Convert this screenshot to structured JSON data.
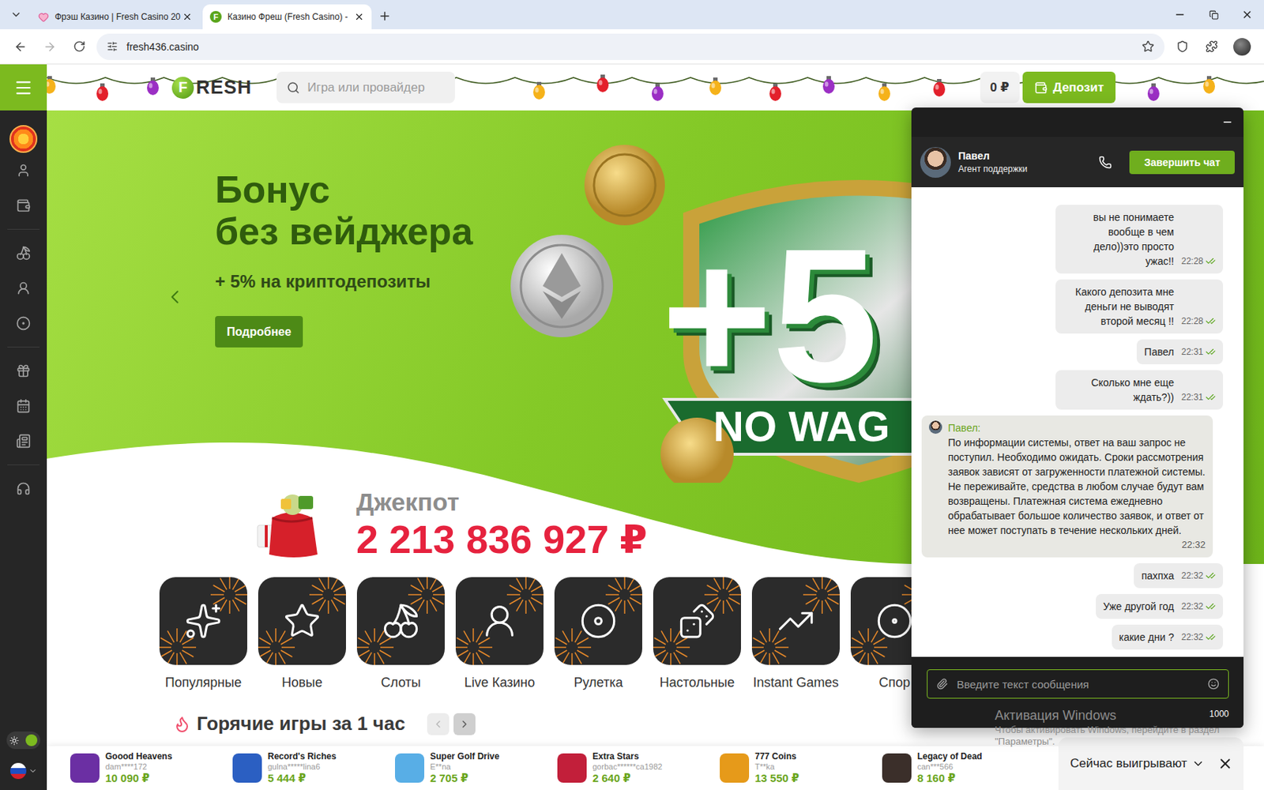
{
  "browser": {
    "tabs": [
      {
        "title": "Фрэш Казино | Fresh Casino 20",
        "selected": false,
        "kind": "heart"
      },
      {
        "title": "Казино Фреш (Fresh Casino) -",
        "selected": true,
        "kind": "letter",
        "letter": "F"
      }
    ],
    "url": "fresh436.casino"
  },
  "sidebar": {
    "theme_toggle_on": true
  },
  "header": {
    "logo_mark": "F",
    "logo_text": "RESH",
    "search_placeholder": "Игра или провайдер",
    "balance": "0 ₽",
    "deposit": "Депозит"
  },
  "banner": {
    "title_lines": [
      "Бонус",
      "без вейджера"
    ],
    "subtitle": "+ 5% на криптодепозиты",
    "button": "Подробнее",
    "art_big": "+5",
    "art_ribbon": "NO WAG"
  },
  "jackpot": {
    "label": "Джекпот",
    "amount": "2 213 836 927 ₽"
  },
  "categories": [
    {
      "label": "Популярные",
      "kind": "stars"
    },
    {
      "label": "Новые",
      "kind": "new"
    },
    {
      "label": "Слоты",
      "kind": "slots"
    },
    {
      "label": "Live Казино",
      "kind": "live"
    },
    {
      "label": "Рулетка",
      "kind": "roulette"
    },
    {
      "label": "Настольные",
      "kind": "table"
    },
    {
      "label": "Instant Games",
      "kind": "instant"
    },
    {
      "label": "Спор",
      "kind": "sport"
    }
  ],
  "hot_games": {
    "title": "Горячие игры за 1 час",
    "nav": [
      {
        "kind": "prev",
        "disabled": true
      },
      {
        "kind": "next",
        "disabled": false
      }
    ]
  },
  "winners": [
    {
      "game": "Goood Heavens",
      "user": "dam****172",
      "amount": "10 090 ₽",
      "color": "#6b2fa3"
    },
    {
      "game": "Record's Riches",
      "user": "gulna*****lina6",
      "amount": "5 444 ₽",
      "color": "#2b5fc2"
    },
    {
      "game": "Super Golf Drive",
      "user": "E**na",
      "amount": "2 705 ₽",
      "color": "#58aee6"
    },
    {
      "game": "Extra Stars",
      "user": "gorbac******ca1982",
      "amount": "2 640 ₽",
      "color": "#c21f3a"
    },
    {
      "game": "777 Coins",
      "user": "T**ka",
      "amount": "13 550 ₽",
      "color": "#e69a1a"
    },
    {
      "game": "Legacy of Dead",
      "user": "can***566",
      "amount": "8 160 ₽",
      "color": "#3b2f2a"
    }
  ],
  "winners_toggle": {
    "label": "Сейчас выигрывают"
  },
  "chat": {
    "agent": {
      "name": "Павел",
      "role": "Агент поддержки"
    },
    "end_button": "Завершить чат",
    "messages": [
      {
        "from": "user",
        "text": "вы не понимаете вообще в чем дело))это просто ужас!!",
        "time": "22:28",
        "read": true
      },
      {
        "from": "user",
        "text": "Какого депозита мне деньги не выводят второй месяц !!",
        "time": "22:28",
        "read": true
      },
      {
        "from": "user",
        "text": "Павел",
        "time": "22:31",
        "read": true
      },
      {
        "from": "user",
        "text": "Сколько мне еще ждать?))",
        "time": "22:31",
        "read": true
      },
      {
        "from": "agent",
        "name": "Павел:",
        "text": "По информации системы, ответ на ваш запрос не поступил. Необходимо ожидать. Сроки рассмотрения заявок зависят от загруженности платежной системы. Не переживайте, средства в любом случае будут вам возвращены. Платежная система ежедневно обрабатывает большое количество заявок, и ответ от нее может поступать в течение нескольких дней.",
        "time": "22:32"
      },
      {
        "from": "user",
        "text": "пахпха",
        "time": "22:32",
        "read": true
      },
      {
        "from": "user",
        "text": "Уже другой год",
        "time": "22:32",
        "read": true
      },
      {
        "from": "user",
        "text": "какие дни ?",
        "time": "22:32",
        "read": true
      }
    ],
    "input_placeholder": "Введите текст сообщения",
    "char_limit": "1000"
  },
  "watermark": {
    "title": "Активация Windows",
    "lines": [
      "Чтобы активировать Windows, перейдите в раздел",
      "\"Параметры\"."
    ]
  }
}
